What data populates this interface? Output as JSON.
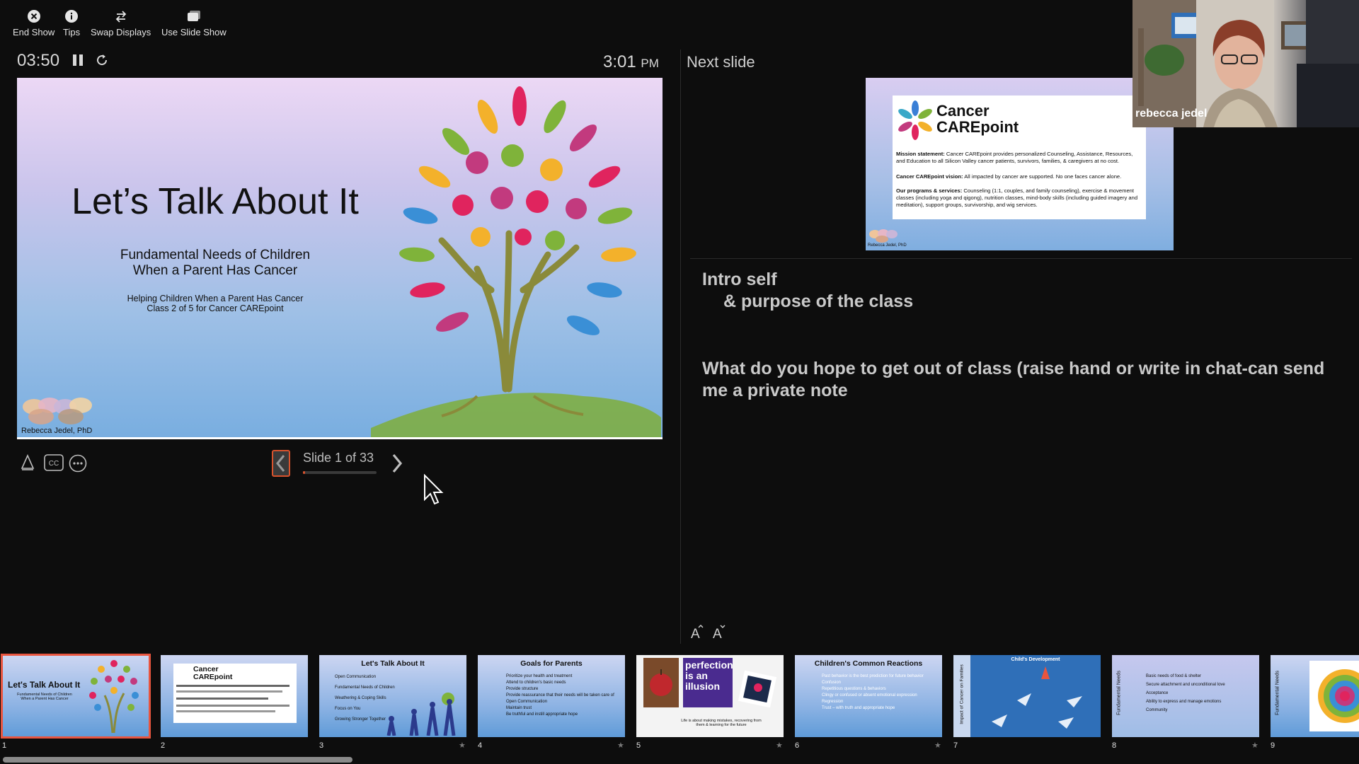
{
  "toolbar": {
    "end_show": "End Show",
    "tips": "Tips",
    "swap_displays": "Swap Displays",
    "use_slide_show": "Use Slide Show"
  },
  "presenter": {
    "elapsed": "03:50",
    "clock_time": "3:01",
    "clock_ampm": "PM",
    "next_slide_label": "Next slide",
    "slide_counter": "Slide 1 of 33",
    "progress_fraction": 0.03
  },
  "current_slide": {
    "title": "Let’s Talk About It",
    "subtitle_1": "Fundamental Needs of Children",
    "subtitle_2": "When a Parent Has Cancer",
    "small_1": "Helping Children When a Parent Has Cancer",
    "small_2": "Class 2 of 5 for Cancer CAREpoint",
    "author": "Rebecca Jedel, PhD"
  },
  "next_slide": {
    "brand_1": "Cancer",
    "brand_2": "CAREpoint",
    "mission_label": "Mission statement:",
    "mission": "Cancer CAREpoint provides personalized Counseling, Assistance, Resources, and Education to all Silicon Valley cancer patients, survivors, families, & caregivers at no cost.",
    "vision_label": "Cancer CAREpoint vision:",
    "vision": "All impacted by cancer are supported. No one faces cancer alone.",
    "programs_label": "Our programs & services:",
    "programs": "Counseling (1:1, couples, and family counseling), exercise & movement classes (including yoga and qigong), nutrition classes, mind-body skills (including guided imagery and meditation), support groups, survivorship, and wig services.",
    "author": "Rebecca Jedel, PhD"
  },
  "notes": {
    "line_1": "Intro self",
    "line_2": "& purpose of the class",
    "line_3": "What do you hope to get out of class (raise hand or write in chat-can send me a private note"
  },
  "webcam": {
    "participant_name": "rebecca jedel"
  },
  "thumbnails": [
    {
      "num": "1",
      "title": "Let's Talk About It",
      "sub": "Fundamental Needs of Children When a Parent Has Cancer"
    },
    {
      "num": "2",
      "title": "Cancer CAREpoint"
    },
    {
      "num": "3",
      "title": "Let's Talk About It",
      "lines": [
        "Open Communication",
        "Fundamental Needs of Children",
        "Weathering & Coping Skills",
        "Focus on You",
        "Growing Stronger Together"
      ]
    },
    {
      "num": "4",
      "title": "Goals for Parents",
      "lines": [
        "Prioritize your health and treatment",
        "Attend to children's basic needs",
        "Provide structure",
        "Provide reassurance that their needs will be taken care of",
        "Open Communication",
        "Maintain trust",
        "Be truthful and instill appropriate hope"
      ]
    },
    {
      "num": "5",
      "title": "perfection is an illusion",
      "caption": "Life is about making mistakes, recovering from them & learning for the future"
    },
    {
      "num": "6",
      "title": "Children's Common Reactions",
      "lines": [
        "Past behavior is the best prediction for future behavior",
        "Confusion",
        "Repetitious questions & behaviors",
        "Clingy or confused or absent emotional expression",
        "Regression",
        "Trust – with truth and appropriate hope"
      ]
    },
    {
      "num": "7",
      "title": "Child's Development",
      "side": "Impact of Cancer on Families"
    },
    {
      "num": "8",
      "side": "Fundamental Needs",
      "lines": [
        "Basic needs of food & shelter",
        "Secure attachment and unconditional love",
        "Acceptance",
        "Ability to express and manage emotions",
        "Community"
      ]
    },
    {
      "num": "9",
      "side": "Fundamental Needs"
    }
  ],
  "colors": {
    "accent": "#e8553f",
    "background": "#0d0d0d"
  }
}
